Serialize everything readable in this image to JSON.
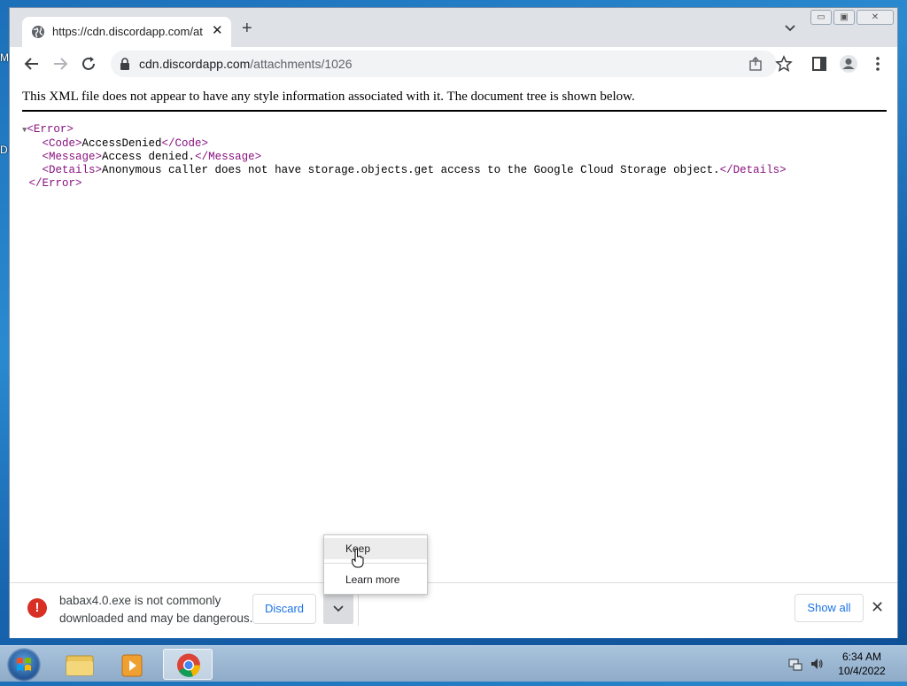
{
  "desktop": {
    "left_labels": [
      "M",
      "D"
    ]
  },
  "browser": {
    "tab": {
      "title": "https://cdn.discordapp.com/attachments/1026",
      "close": "✕"
    },
    "new_tab": "+",
    "window_controls": {
      "minimize": "▭",
      "maximize": "▣",
      "close": "✕"
    },
    "omnibox": {
      "host": "cdn.discordapp.com",
      "path": "/attachments/1026"
    }
  },
  "page": {
    "xml_notice": "This XML file does not appear to have any style information associated with it. The document tree is shown below.",
    "xml": {
      "root_open": "<Error>",
      "code_open": "<Code>",
      "code_value": "AccessDenied",
      "code_close": "</Code>",
      "message_open": "<Message>",
      "message_value": "Access denied.",
      "message_close": "</Message>",
      "details_open": "<Details>",
      "details_value": "Anonymous caller does not have storage.objects.get access to the Google Cloud Storage object.",
      "details_close": "</Details>",
      "root_close": "</Error>"
    }
  },
  "download_bar": {
    "warning_icon": "!",
    "message_line1": "babax4.0.exe is not commonly",
    "message_line2": "downloaded and may be dangerous.",
    "discard_label": "Discard",
    "show_all_label": "Show all",
    "close": "✕"
  },
  "download_menu": {
    "items": [
      "Keep",
      "Learn more"
    ]
  },
  "taskbar": {
    "time": "6:34 AM",
    "date": "10/4/2022"
  }
}
